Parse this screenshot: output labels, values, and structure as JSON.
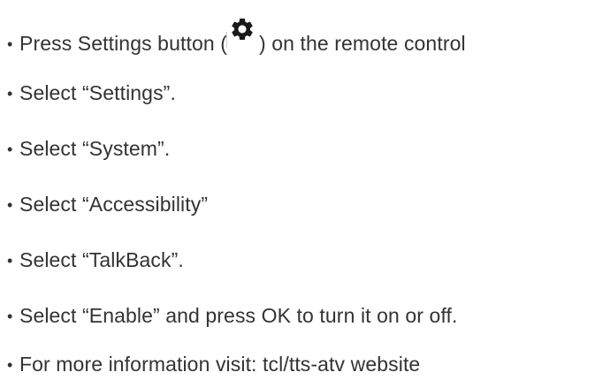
{
  "bullet_char": "•",
  "steps": [
    {
      "before_icon": "Press Settings button (",
      "icon": "gear-icon",
      "after_icon": ") on the remote control"
    },
    {
      "text": "Select “Settings”."
    },
    {
      "text": "Select “System”."
    },
    {
      "text": "Select “Accessibility”"
    },
    {
      "text": "Select “TalkBack”."
    },
    {
      "text": "Select “Enable” and press OK to turn it on or off."
    },
    {
      "text": "For more information visit: tcl/tts-atv website"
    }
  ],
  "colors": {
    "text": "#333333",
    "icon": "#1a1a1a",
    "background": "#ffffff"
  }
}
